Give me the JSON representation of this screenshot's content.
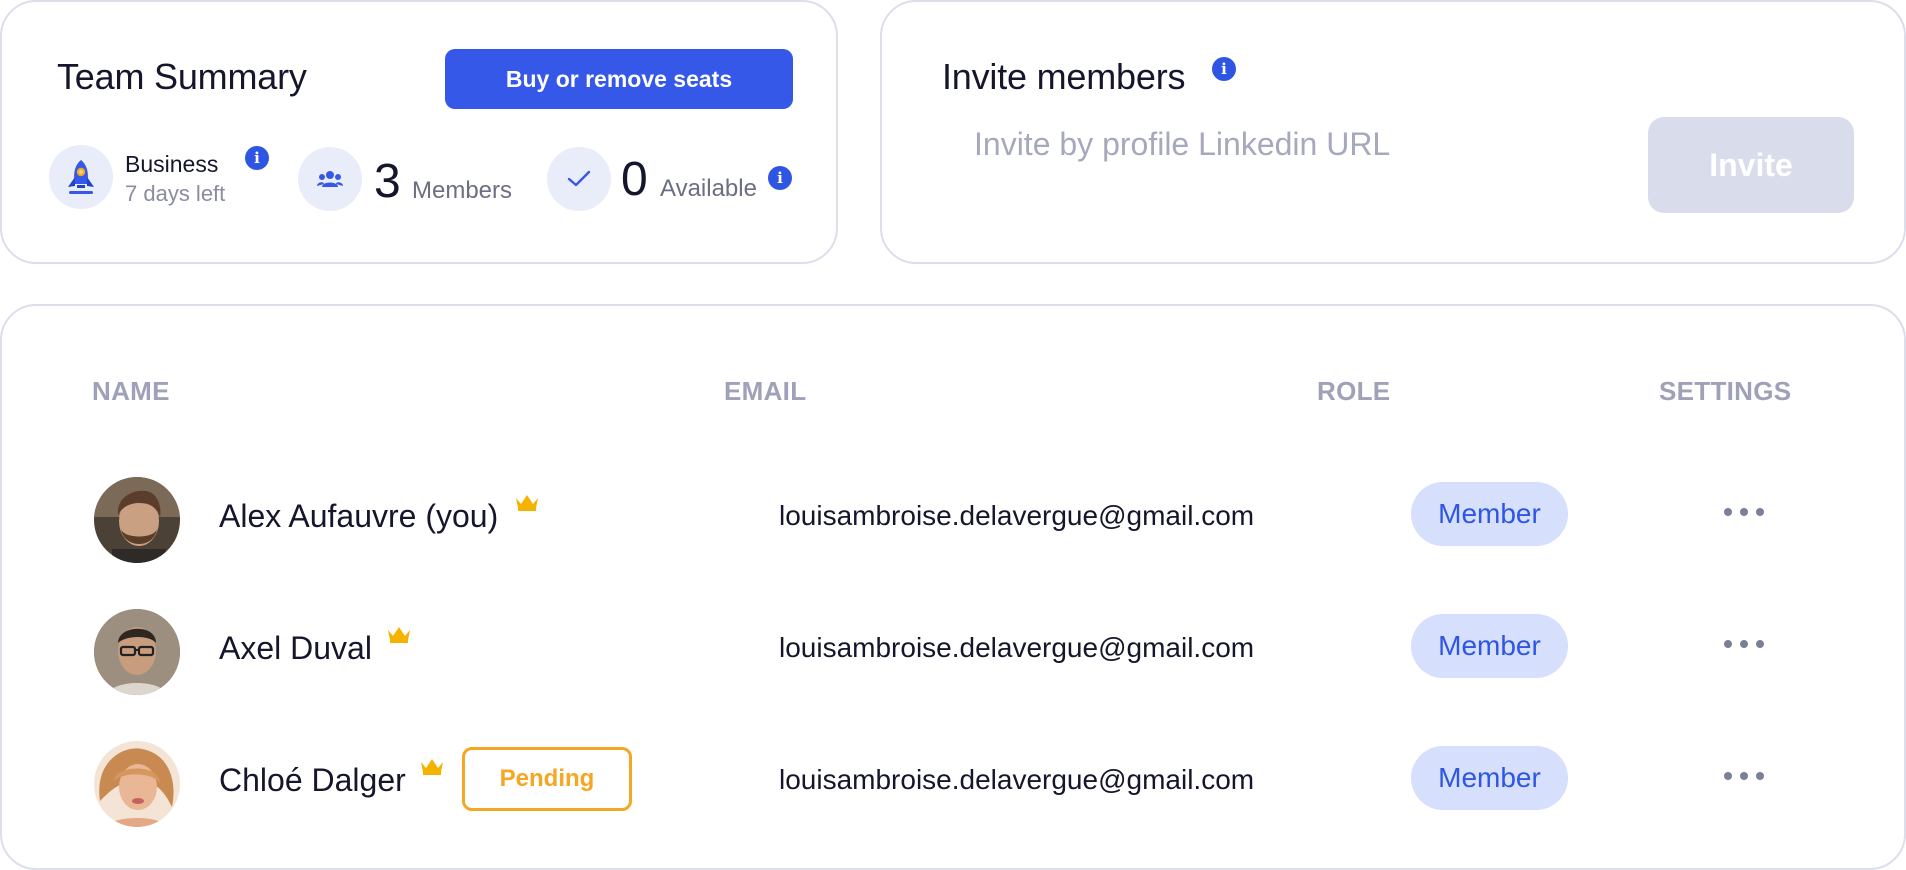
{
  "team_summary": {
    "title": "Team Summary",
    "buy_button": "Buy or remove seats",
    "plan": {
      "name": "Business",
      "sub": "7 days left",
      "icon": "rocket-icon"
    },
    "members": {
      "count": "3",
      "label": "Members",
      "icon": "users-icon"
    },
    "available": {
      "count": "0",
      "label": "Available",
      "icon": "check-icon"
    },
    "info_glyph": "i"
  },
  "invite": {
    "title": "Invite members",
    "placeholder": "Invite by profile Linkedin URL",
    "button": "Invite"
  },
  "table": {
    "headers": {
      "name": "NAME",
      "email": "EMAIL",
      "role": "ROLE",
      "settings": "SETTINGS"
    },
    "rows": [
      {
        "name": "Alex Aufauvre (you)",
        "email": "louisambroise.delavergue@gmail.com",
        "role": "Member",
        "status": "",
        "owner_icon": "crown-icon"
      },
      {
        "name": "Axel Duval",
        "email": "louisambroise.delavergue@gmail.com",
        "role": "Member",
        "status": "",
        "owner_icon": "crown-icon"
      },
      {
        "name": "Chloé Dalger",
        "email": "louisambroise.delavergue@gmail.com",
        "role": "Member",
        "status": "Pending",
        "owner_icon": "crown-icon"
      }
    ]
  },
  "colors": {
    "accent": "#3558e8",
    "pending": "#f5a623",
    "crown": "#f5b300",
    "role_bg": "#d6dffc",
    "border": "#dcdeeb"
  }
}
